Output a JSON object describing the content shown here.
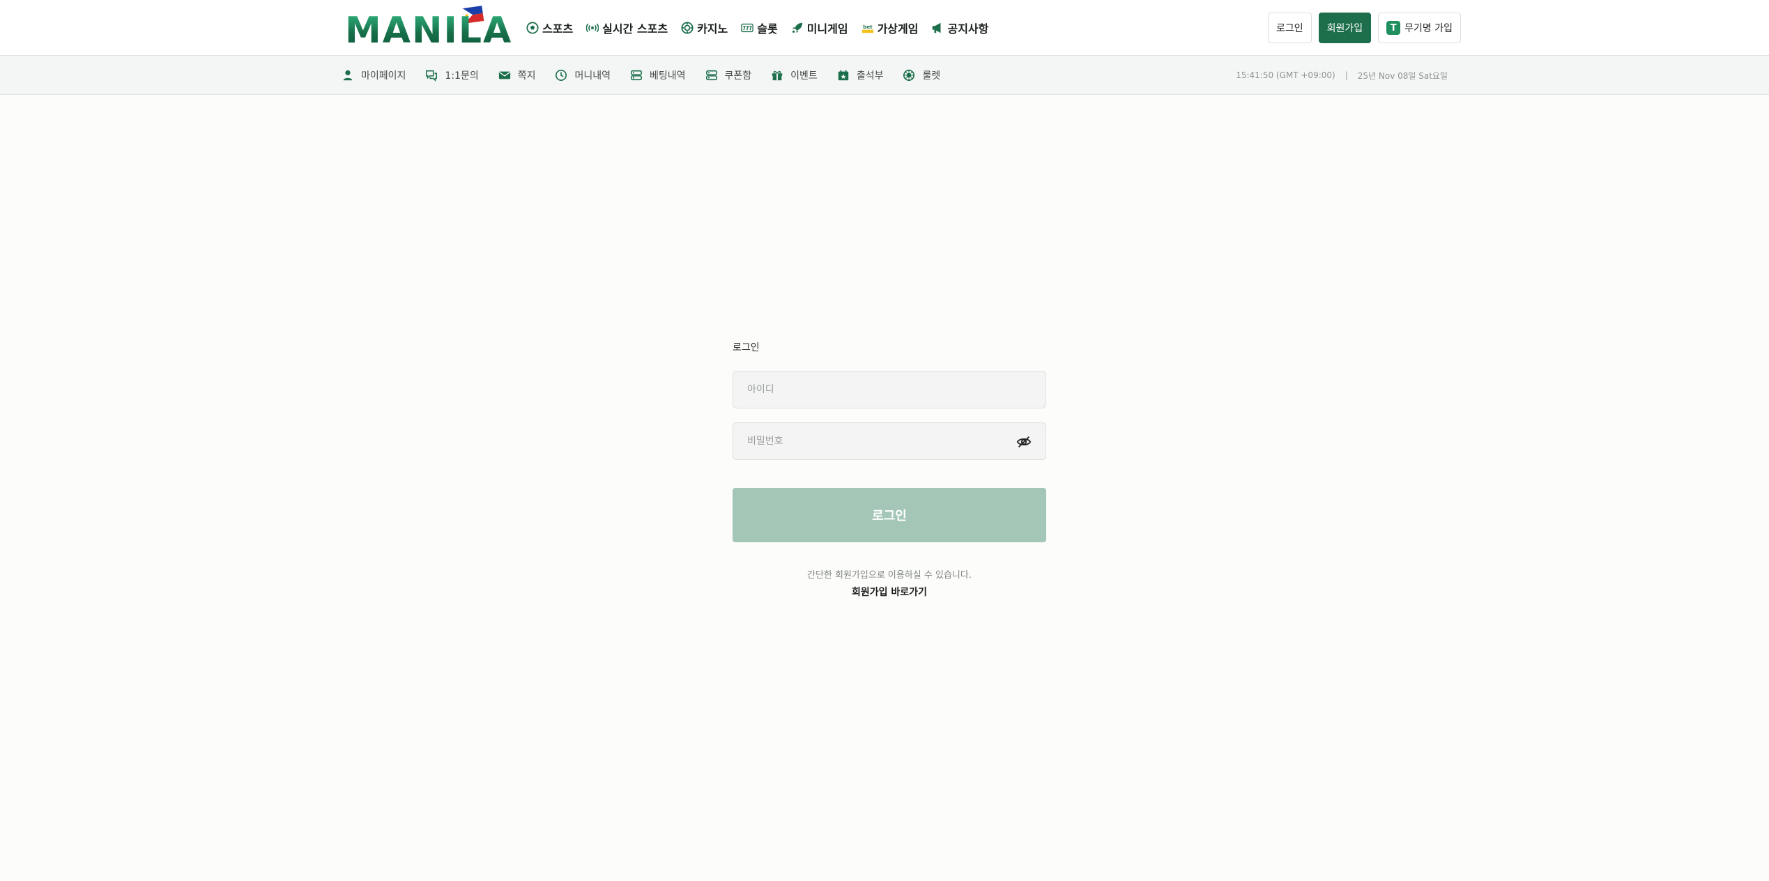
{
  "brand": {
    "logo_text": "MANILA",
    "accent": "#1d6f4c",
    "button_disabled": "#a4c6b7"
  },
  "main_nav": [
    {
      "label": "스포츠",
      "icon": "soccer-ball-icon"
    },
    {
      "label": "실시간 스포츠",
      "icon": "live-broadcast-icon"
    },
    {
      "label": "카지노",
      "icon": "casino-chip-icon"
    },
    {
      "label": "슬롯",
      "icon": "slot-777-icon"
    },
    {
      "label": "미니게임",
      "icon": "rocket-icon"
    },
    {
      "label": "가상게임",
      "icon": "bet-icon"
    },
    {
      "label": "공지사항",
      "icon": "megaphone-icon"
    }
  ],
  "auth": {
    "login": "로그인",
    "signup": "회원가입",
    "anon_signup": "무기명 가입",
    "anon_badge": "T"
  },
  "sub_nav": [
    {
      "label": "마이페이지",
      "icon": "user-icon"
    },
    {
      "label": "1:1문의",
      "icon": "chat-icon"
    },
    {
      "label": "쪽지",
      "icon": "mail-icon"
    },
    {
      "label": "머니내역",
      "icon": "clock-icon"
    },
    {
      "label": "베팅내역",
      "icon": "list-icon"
    },
    {
      "label": "쿠폰함",
      "icon": "coupon-icon"
    },
    {
      "label": "이벤트",
      "icon": "gift-icon"
    },
    {
      "label": "출석부",
      "icon": "calendar-star-icon"
    },
    {
      "label": "룰렛",
      "icon": "roulette-icon"
    }
  ],
  "clock": {
    "time": "15:41:50 (GMT +09:00)",
    "separator": "|",
    "date": "25년 Nov 08일 Sat요일"
  },
  "login": {
    "title": "로그인",
    "id_placeholder": "아이디",
    "password_placeholder": "비밀번호",
    "submit": "로그인",
    "hint": "간단한 회원가입으로 이용하실 수 있습니다.",
    "join_link": "회원가입 바로가기"
  }
}
